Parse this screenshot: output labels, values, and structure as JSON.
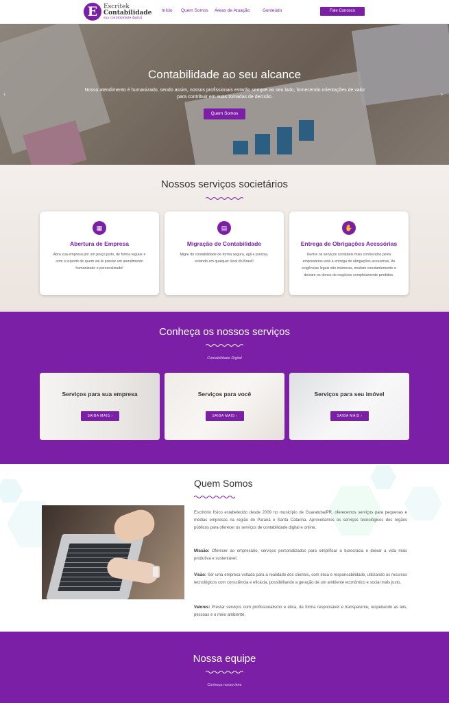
{
  "header": {
    "logo_mark": "E",
    "logo_line1": "Escritek",
    "logo_line2": "Contabilidade",
    "logo_tagline": "sua contabilidade digital",
    "nav": [
      {
        "label": "Início"
      },
      {
        "label": "Quem Somos"
      },
      {
        "label": "Áreas de Atuação",
        "chevron": "chevron-down-icon"
      },
      {
        "label": "Conteúdo",
        "chevron": "chevron-down-icon"
      }
    ],
    "contact_button": "Fale Conosco"
  },
  "hero": {
    "title": "Contabilidade ao seu alcance",
    "text": "Nosso atendimento é humanizado, sendo assim, nossos profissionais estarão sempre ao seu lado, fornecendo orientações de valor para contribuir em suas tomadas de decisão.",
    "button": "Quem Somos",
    "prev_arrow": "‹",
    "next_arrow": "›"
  },
  "societarios": {
    "title": "Nossos serviços societários",
    "cards": [
      {
        "icon": "store-icon",
        "title": "Abertura de Empresa",
        "text": "Abra sua empresa por um preço justo, de forma regular e com o suporte de quem vai te prestar um atendimento humanizado e personalizado!"
      },
      {
        "icon": "document-icon",
        "title": "Migração de Contabilidade",
        "text": "Migre do contabilidade de forma segura, ágil e precisa, estando em qualquer local do Brasil!"
      },
      {
        "icon": "handshake-icon",
        "title": "Entrega de Obrigações Acessórias",
        "text": "Dentre os serviços contábeis mais conhecidos pelos empresários está a entrega de obrigações acessórias. As exigências legais são inúmeras, mudam constantemente e deixam os donos de negócios completamente perdidos."
      }
    ]
  },
  "servicos": {
    "title": "Conheça os nossos serviços",
    "subtitle": "Contabilidade Digital",
    "items": [
      {
        "title": "Serviços para sua empresa",
        "button": "SAIBA MAIS ›"
      },
      {
        "title": "Serviços para você",
        "button": "SAIBA MAIS ›"
      },
      {
        "title": "Serviços para seu imóvel",
        "button": "SAIBA MAIS ›"
      }
    ]
  },
  "about": {
    "title": "Quem Somos",
    "intro": "Escritório físico estabelecido desde 2009 no município de Guaratuba/PR, oferecemos serviços para pequenas e médias empresas na região do Paraná e Santa Catarina. Aproveitamos os serviços tecnológicos dos órgãos públicos para oferecer os serviços de contabilidade digital e online.",
    "missao_label": "Missão:",
    "missao": "Oferecer ao empresário, serviços personalizados para simplificar a burocracia e deixar a vida mais produtiva e sustentável.",
    "visao_label": "Visão:",
    "visao": "Ser uma empresa voltada para a realidade dos clientes, com ética e responsabilidade, utilizando os recursos tecnológicos com consciência e eficácia, possibilitando a geração de um ambiente econômico e social mais justo.",
    "valores_label": "Valores:",
    "valores": "Prestar serviços com profissionalismo e ética, de forma responsável e transparente, respeitando as leis, pessoas e o meio ambiente."
  },
  "team": {
    "title": "Nossa equipe",
    "subtitle": "Conheça nosso time"
  },
  "colors": {
    "brand": "#7a1fa6",
    "accent_light": "#e6d4ef"
  }
}
